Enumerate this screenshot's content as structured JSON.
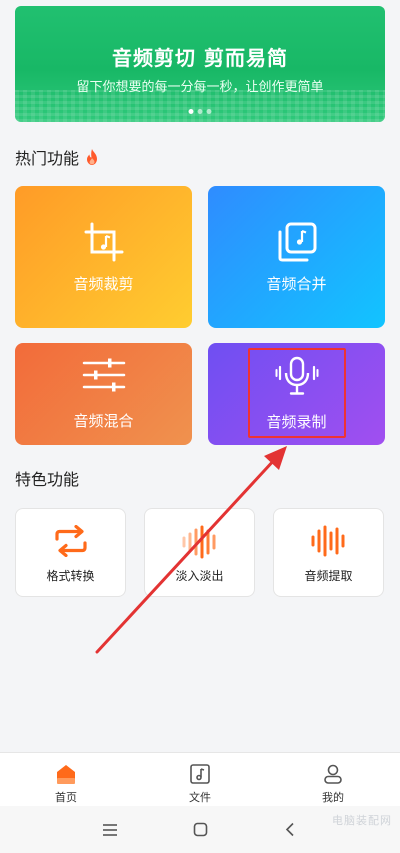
{
  "banner": {
    "title": "音频剪切 剪而易简",
    "subtitle": "留下你想要的每一分每一秒，让创作更简单"
  },
  "hot_section": {
    "title": "热门功能"
  },
  "hot_cards": [
    {
      "label": "音频裁剪",
      "icon": "crop-music-icon"
    },
    {
      "label": "音频合并",
      "icon": "merge-music-icon"
    },
    {
      "label": "音频混合",
      "icon": "mixer-sliders-icon"
    },
    {
      "label": "音频录制",
      "icon": "microphone-icon"
    }
  ],
  "feature_section": {
    "title": "特色功能"
  },
  "features": [
    {
      "label": "格式转换",
      "icon": "convert-arrows-icon"
    },
    {
      "label": "淡入淡出",
      "icon": "fade-waveform-icon"
    },
    {
      "label": "音频提取",
      "icon": "extract-waveform-icon"
    }
  ],
  "tabbar": [
    {
      "label": "首页",
      "icon": "home-icon",
      "active": true
    },
    {
      "label": "文件",
      "icon": "music-file-icon",
      "active": false
    },
    {
      "label": "我的",
      "icon": "profile-icon",
      "active": false
    }
  ],
  "watermark": "电脑装配网",
  "colors": {
    "accent_orange": "#ff6a1a",
    "banner_green": "#1dbf6d",
    "highlight_red": "#e33333"
  }
}
